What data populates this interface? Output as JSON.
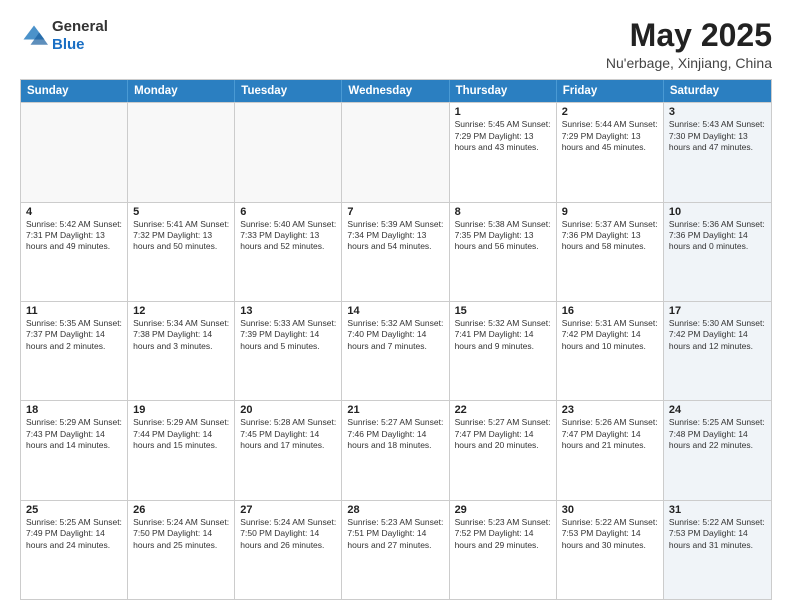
{
  "logo": {
    "general": "General",
    "blue": "Blue"
  },
  "header": {
    "month_title": "May 2025",
    "location": "Nu'erbage, Xinjiang, China"
  },
  "weekdays": [
    "Sunday",
    "Monday",
    "Tuesday",
    "Wednesday",
    "Thursday",
    "Friday",
    "Saturday"
  ],
  "rows": [
    [
      {
        "day": "",
        "info": "",
        "empty": true
      },
      {
        "day": "",
        "info": "",
        "empty": true
      },
      {
        "day": "",
        "info": "",
        "empty": true
      },
      {
        "day": "",
        "info": "",
        "empty": true
      },
      {
        "day": "1",
        "info": "Sunrise: 5:45 AM\nSunset: 7:29 PM\nDaylight: 13 hours\nand 43 minutes.",
        "empty": false
      },
      {
        "day": "2",
        "info": "Sunrise: 5:44 AM\nSunset: 7:29 PM\nDaylight: 13 hours\nand 45 minutes.",
        "empty": false
      },
      {
        "day": "3",
        "info": "Sunrise: 5:43 AM\nSunset: 7:30 PM\nDaylight: 13 hours\nand 47 minutes.",
        "empty": false,
        "shaded": true
      }
    ],
    [
      {
        "day": "4",
        "info": "Sunrise: 5:42 AM\nSunset: 7:31 PM\nDaylight: 13 hours\nand 49 minutes.",
        "empty": false
      },
      {
        "day": "5",
        "info": "Sunrise: 5:41 AM\nSunset: 7:32 PM\nDaylight: 13 hours\nand 50 minutes.",
        "empty": false
      },
      {
        "day": "6",
        "info": "Sunrise: 5:40 AM\nSunset: 7:33 PM\nDaylight: 13 hours\nand 52 minutes.",
        "empty": false
      },
      {
        "day": "7",
        "info": "Sunrise: 5:39 AM\nSunset: 7:34 PM\nDaylight: 13 hours\nand 54 minutes.",
        "empty": false
      },
      {
        "day": "8",
        "info": "Sunrise: 5:38 AM\nSunset: 7:35 PM\nDaylight: 13 hours\nand 56 minutes.",
        "empty": false
      },
      {
        "day": "9",
        "info": "Sunrise: 5:37 AM\nSunset: 7:36 PM\nDaylight: 13 hours\nand 58 minutes.",
        "empty": false
      },
      {
        "day": "10",
        "info": "Sunrise: 5:36 AM\nSunset: 7:36 PM\nDaylight: 14 hours\nand 0 minutes.",
        "empty": false,
        "shaded": true
      }
    ],
    [
      {
        "day": "11",
        "info": "Sunrise: 5:35 AM\nSunset: 7:37 PM\nDaylight: 14 hours\nand 2 minutes.",
        "empty": false
      },
      {
        "day": "12",
        "info": "Sunrise: 5:34 AM\nSunset: 7:38 PM\nDaylight: 14 hours\nand 3 minutes.",
        "empty": false
      },
      {
        "day": "13",
        "info": "Sunrise: 5:33 AM\nSunset: 7:39 PM\nDaylight: 14 hours\nand 5 minutes.",
        "empty": false
      },
      {
        "day": "14",
        "info": "Sunrise: 5:32 AM\nSunset: 7:40 PM\nDaylight: 14 hours\nand 7 minutes.",
        "empty": false
      },
      {
        "day": "15",
        "info": "Sunrise: 5:32 AM\nSunset: 7:41 PM\nDaylight: 14 hours\nand 9 minutes.",
        "empty": false
      },
      {
        "day": "16",
        "info": "Sunrise: 5:31 AM\nSunset: 7:42 PM\nDaylight: 14 hours\nand 10 minutes.",
        "empty": false
      },
      {
        "day": "17",
        "info": "Sunrise: 5:30 AM\nSunset: 7:42 PM\nDaylight: 14 hours\nand 12 minutes.",
        "empty": false,
        "shaded": true
      }
    ],
    [
      {
        "day": "18",
        "info": "Sunrise: 5:29 AM\nSunset: 7:43 PM\nDaylight: 14 hours\nand 14 minutes.",
        "empty": false
      },
      {
        "day": "19",
        "info": "Sunrise: 5:29 AM\nSunset: 7:44 PM\nDaylight: 14 hours\nand 15 minutes.",
        "empty": false
      },
      {
        "day": "20",
        "info": "Sunrise: 5:28 AM\nSunset: 7:45 PM\nDaylight: 14 hours\nand 17 minutes.",
        "empty": false
      },
      {
        "day": "21",
        "info": "Sunrise: 5:27 AM\nSunset: 7:46 PM\nDaylight: 14 hours\nand 18 minutes.",
        "empty": false
      },
      {
        "day": "22",
        "info": "Sunrise: 5:27 AM\nSunset: 7:47 PM\nDaylight: 14 hours\nand 20 minutes.",
        "empty": false
      },
      {
        "day": "23",
        "info": "Sunrise: 5:26 AM\nSunset: 7:47 PM\nDaylight: 14 hours\nand 21 minutes.",
        "empty": false
      },
      {
        "day": "24",
        "info": "Sunrise: 5:25 AM\nSunset: 7:48 PM\nDaylight: 14 hours\nand 22 minutes.",
        "empty": false,
        "shaded": true
      }
    ],
    [
      {
        "day": "25",
        "info": "Sunrise: 5:25 AM\nSunset: 7:49 PM\nDaylight: 14 hours\nand 24 minutes.",
        "empty": false
      },
      {
        "day": "26",
        "info": "Sunrise: 5:24 AM\nSunset: 7:50 PM\nDaylight: 14 hours\nand 25 minutes.",
        "empty": false
      },
      {
        "day": "27",
        "info": "Sunrise: 5:24 AM\nSunset: 7:50 PM\nDaylight: 14 hours\nand 26 minutes.",
        "empty": false
      },
      {
        "day": "28",
        "info": "Sunrise: 5:23 AM\nSunset: 7:51 PM\nDaylight: 14 hours\nand 27 minutes.",
        "empty": false
      },
      {
        "day": "29",
        "info": "Sunrise: 5:23 AM\nSunset: 7:52 PM\nDaylight: 14 hours\nand 29 minutes.",
        "empty": false
      },
      {
        "day": "30",
        "info": "Sunrise: 5:22 AM\nSunset: 7:53 PM\nDaylight: 14 hours\nand 30 minutes.",
        "empty": false
      },
      {
        "day": "31",
        "info": "Sunrise: 5:22 AM\nSunset: 7:53 PM\nDaylight: 14 hours\nand 31 minutes.",
        "empty": false,
        "shaded": true
      }
    ]
  ]
}
